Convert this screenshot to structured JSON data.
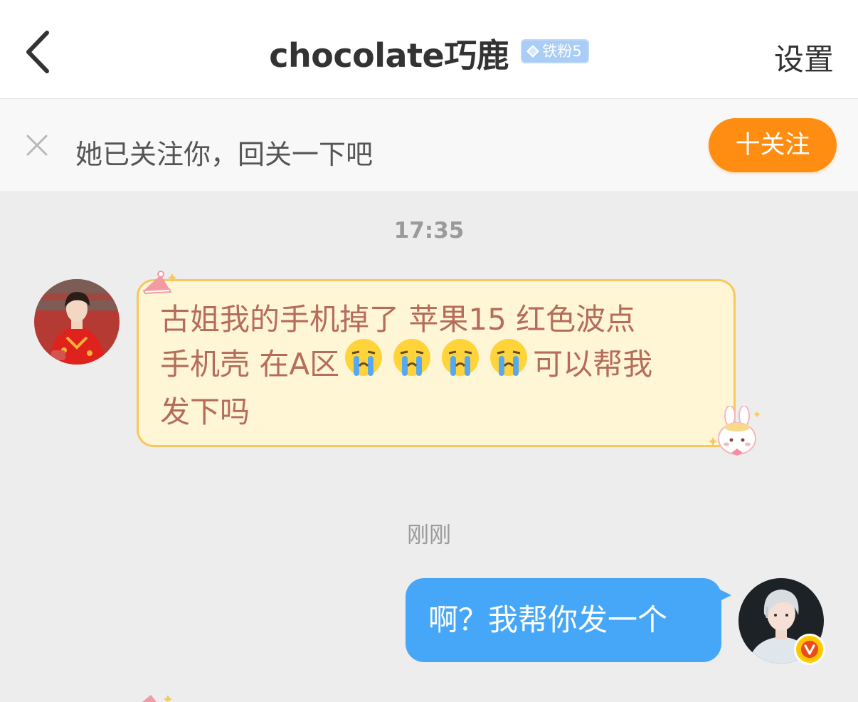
{
  "header": {
    "title": "chocolate巧鹿",
    "fan_badge": "铁粉5",
    "settings_label": "设置"
  },
  "follow_bar": {
    "text": "她已关注你，回关一下吧",
    "button_label": "十关注"
  },
  "messages": [
    {
      "time": "17:35",
      "sender": "other",
      "lines": [
        "古姐我的手机掉了 苹果15 红色波点",
        "手机壳 在A区",
        "可以帮我",
        "发下吗"
      ],
      "emoji": "crying-emoji"
    },
    {
      "time": "刚刚",
      "sender": "self",
      "text": "啊？我帮你发一个"
    }
  ],
  "colors": {
    "accent_orange": "#ff8d12",
    "self_bubble": "#46a7f9",
    "other_bubble_fill": "#fff6d6",
    "other_bubble_border": "#f6c85e",
    "other_text": "#b56d5a",
    "verified_badge": "#ffcc00"
  }
}
